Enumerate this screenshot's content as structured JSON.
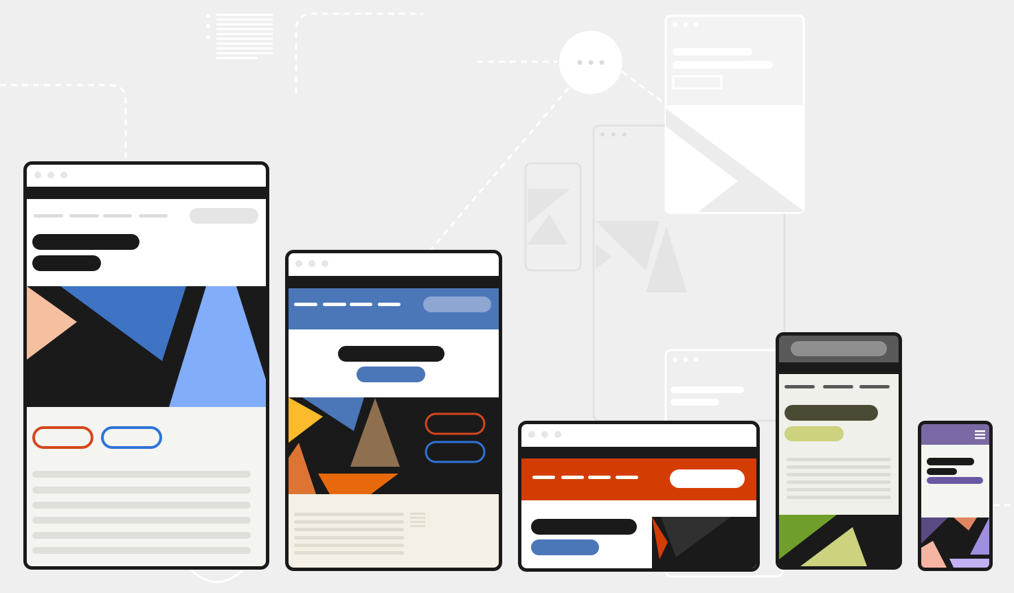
{
  "illustration": {
    "background": "#efefef",
    "outline": "#1a1a1a",
    "devices": [
      {
        "kind": "desktop-browser",
        "accent_colors": [
          "#f6c0a0",
          "#3f73c4",
          "#82adfb",
          "#d5461d",
          "#2f73d6"
        ],
        "body_color": "#f4f4f0"
      },
      {
        "kind": "laptop-browser",
        "accent_colors": [
          "#4b77b9",
          "#fbbb2d",
          "#8e7050",
          "#de7433",
          "#e8690c",
          "#d5461d",
          "#2f73d6"
        ],
        "body_color": "#f4f0e6"
      },
      {
        "kind": "wide-browser",
        "accent_colors": [
          "#d33d04",
          "#4b77b9",
          "#303030"
        ],
        "body_color": "#ffffff"
      },
      {
        "kind": "tablet",
        "accent_colors": [
          "#595959",
          "#4b4b35",
          "#ccd27e",
          "#709e2b"
        ],
        "body_color": "#f0f0ea"
      },
      {
        "kind": "phone",
        "accent_colors": [
          "#7a69a4",
          "#6b58a3",
          "#f6b5a2",
          "#a08fe0",
          "#e08660"
        ],
        "body_color": "#f4f4f0"
      }
    ],
    "icons": [
      "ellipsis-icon",
      "hamburger-menu-icon",
      "text-lines-icon"
    ]
  }
}
